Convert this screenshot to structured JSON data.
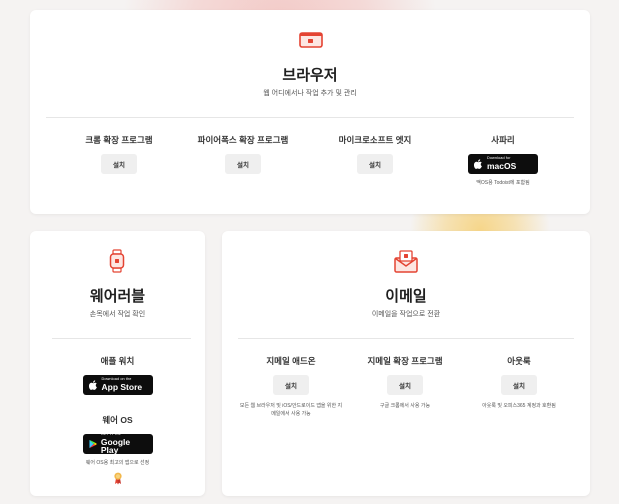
{
  "colors": {
    "accent": "#e44332",
    "background": "#f5f3f2",
    "card": "#ffffff"
  },
  "browser": {
    "title": "브라우저",
    "subtitle": "웹 어디에서나 작업 추가 및 관리",
    "items": [
      {
        "label": "크롬 확장 프로그램",
        "button": "설치"
      },
      {
        "label": "파이어폭스 확장 프로그램",
        "button": "설치"
      },
      {
        "label": "마이크로소프트 엣지",
        "button": "설치"
      }
    ],
    "safari": {
      "label": "사파리",
      "badge_small": "Download for",
      "badge_big": "macOS",
      "note": "맥OS용 Todoist에 포함됨"
    }
  },
  "wearable": {
    "title": "웨어러블",
    "subtitle": "손목에서 작업 확인",
    "apple_watch": {
      "label": "애플 워치",
      "badge_small": "Download on the",
      "badge_big": "App Store"
    },
    "wear_os": {
      "label": "웨어 OS",
      "badge_small": "GET IT ON",
      "badge_big": "Google Play",
      "note": "웨어 OS용 최고의 앱으로 선정"
    }
  },
  "email": {
    "title": "이메일",
    "subtitle": "이메일을 작업으로 전환",
    "items": [
      {
        "label": "지메일 애드온",
        "button": "설치",
        "note": "모든 웹 브라우저 및 iOS/안드로이드 앱을 위한 지메일에서 사용 가능"
      },
      {
        "label": "지메일 확장 프로그램",
        "button": "설치",
        "note": "구글 크롬에서 사용 가능"
      },
      {
        "label": "아웃룩",
        "button": "설치",
        "note": "아웃룩 및 오피스365 계정과 호환됨"
      }
    ]
  }
}
